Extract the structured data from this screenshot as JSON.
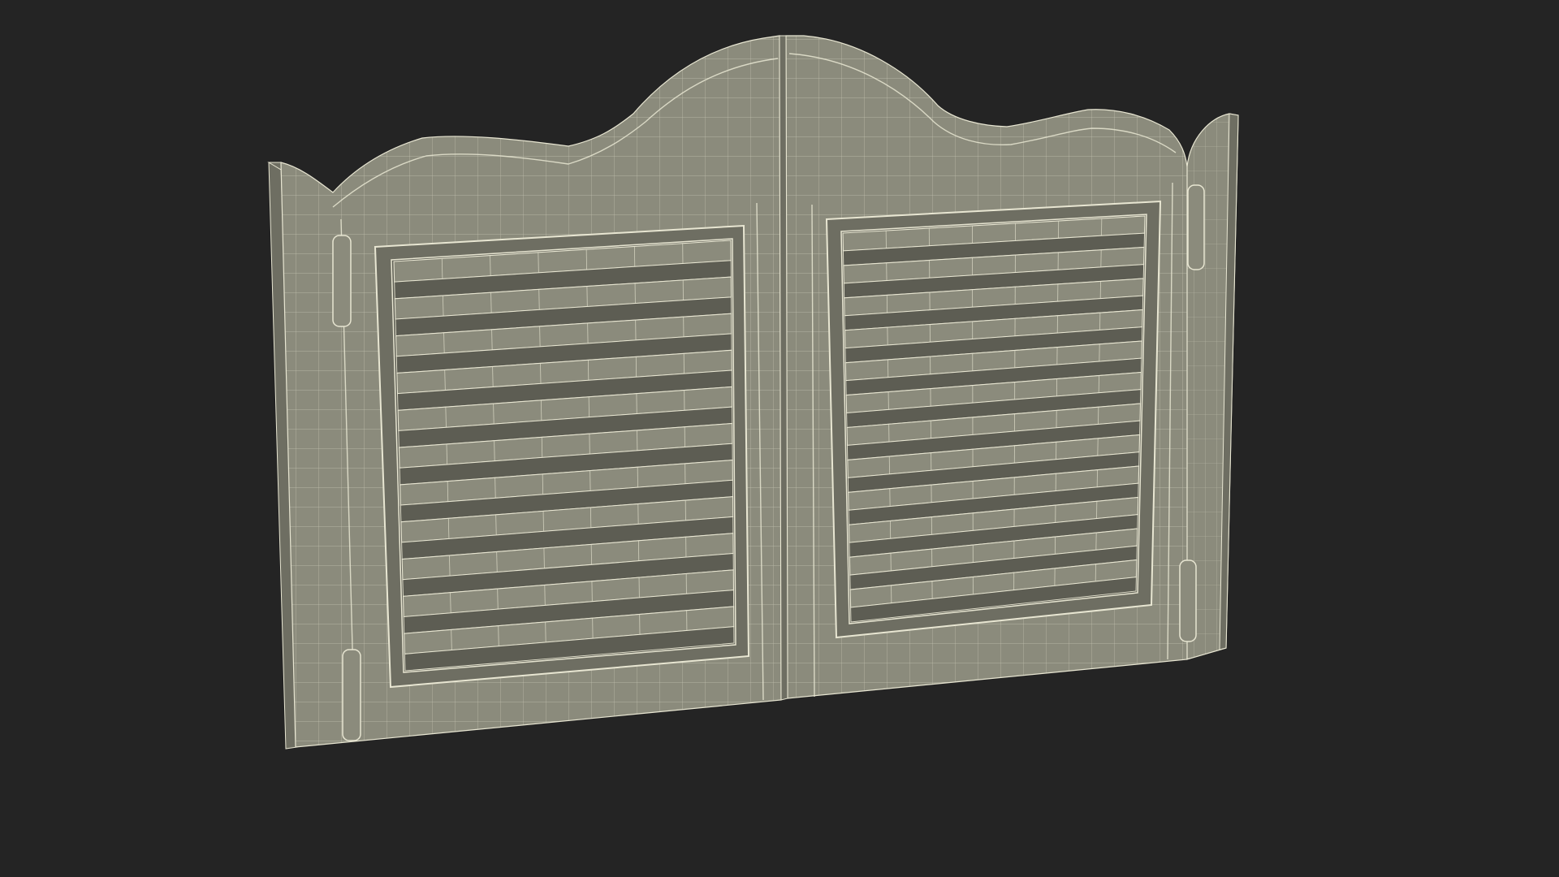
{
  "scene": {
    "subject": "saloon-doors-wireframe",
    "background_color": "#242424",
    "surface_color": "#8B8B7C",
    "surface_dark_color": "#6E6E62",
    "slat_shadow_color": "#5D5D53",
    "edge_color": "#55554B",
    "wire_color": "#E8E6D2",
    "left_door_louvers": 11,
    "right_door_louvers": 12
  }
}
